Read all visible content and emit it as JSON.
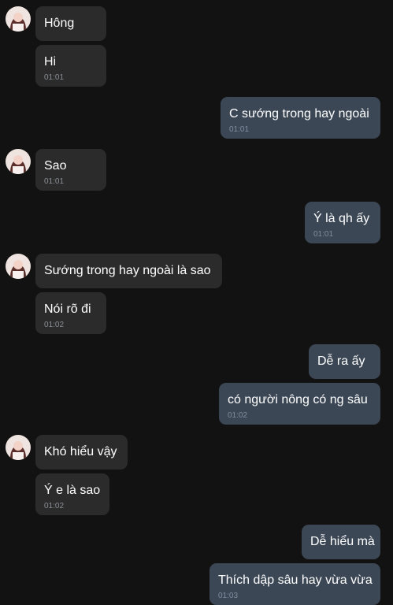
{
  "avatar": {
    "icon": "contact-avatar-photo"
  },
  "messages": [
    {
      "side": "in",
      "text": "Hông",
      "time": ""
    },
    {
      "side": "in",
      "text": "Hi",
      "time": "01:01"
    },
    {
      "side": "out",
      "text": "C sướng trong hay ngoài",
      "time": "01:01"
    },
    {
      "side": "in",
      "text": "Sao",
      "time": "01:01"
    },
    {
      "side": "out",
      "text": "Ý là qh ấy",
      "time": "01:01"
    },
    {
      "side": "in",
      "text": "Sướng trong hay ngoài là sao",
      "time": ""
    },
    {
      "side": "in",
      "text": "Nói rõ đi",
      "time": "01:02"
    },
    {
      "side": "out",
      "text": "Dễ ra ấy",
      "time": ""
    },
    {
      "side": "out",
      "text": "có người nông có ng sâu",
      "time": "01:02"
    },
    {
      "side": "in",
      "text": "Khó hiểu vậy",
      "time": ""
    },
    {
      "side": "in",
      "text": "Ý e là sao",
      "time": "01:02"
    },
    {
      "side": "out",
      "text": "Dễ hiểu mà",
      "time": ""
    },
    {
      "side": "out",
      "text": "Thích dập sâu hay vừa vừa",
      "time": "01:03"
    }
  ],
  "colors": {
    "background": "#121212",
    "incoming_bubble": "#2b2b2b",
    "outgoing_bubble": "#3c4756"
  }
}
